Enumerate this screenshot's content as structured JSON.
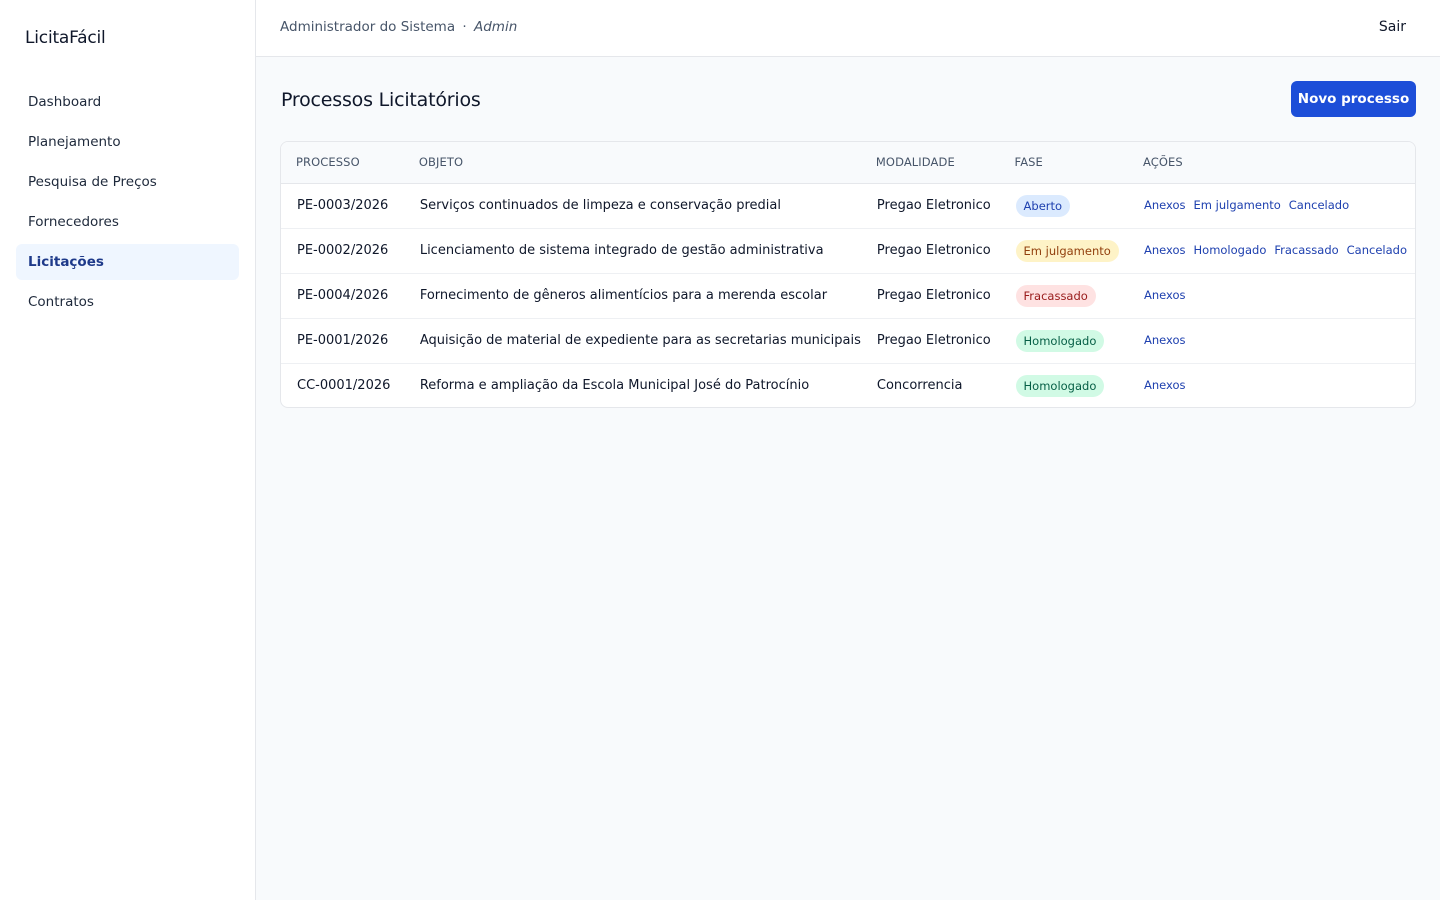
{
  "app": {
    "brand": "LicitaFácil"
  },
  "sidebar": {
    "items": [
      {
        "label": "Dashboard",
        "active": false
      },
      {
        "label": "Planejamento",
        "active": false
      },
      {
        "label": "Pesquisa de Preços",
        "active": false
      },
      {
        "label": "Fornecedores",
        "active": false
      },
      {
        "label": "Licitações",
        "active": true
      },
      {
        "label": "Contratos",
        "active": false
      }
    ]
  },
  "header": {
    "user_name": "Administrador do Sistema",
    "separator": "·",
    "user_role": "Admin",
    "logout_label": "Sair"
  },
  "main": {
    "title": "Processos Licitatórios",
    "new_button_label": "Novo processo",
    "table": {
      "columns": [
        "Processo",
        "Objeto",
        "Modalidade",
        "Fase",
        "Ações"
      ],
      "rows": [
        {
          "processo": "PE-0003/2026",
          "objeto": "Serviços continuados de limpeza e conservação predial",
          "modalidade": "Pregao Eletronico",
          "fase": "Aberto",
          "fase_style": "aberto",
          "acoes": [
            "Anexos",
            "Em julgamento",
            "Cancelado"
          ]
        },
        {
          "processo": "PE-0002/2026",
          "objeto": "Licenciamento de sistema integrado de gestão administrativa",
          "modalidade": "Pregao Eletronico",
          "fase": "Em julgamento",
          "fase_style": "julgamento",
          "acoes": [
            "Anexos",
            "Homologado",
            "Fracassado",
            "Cancelado"
          ]
        },
        {
          "processo": "PE-0004/2026",
          "objeto": "Fornecimento de gêneros alimentícios para a merenda escolar",
          "modalidade": "Pregao Eletronico",
          "fase": "Fracassado",
          "fase_style": "fracassado",
          "acoes": [
            "Anexos"
          ]
        },
        {
          "processo": "PE-0001/2026",
          "objeto": "Aquisição de material de expediente para as secretarias municipais",
          "modalidade": "Pregao Eletronico",
          "fase": "Homologado",
          "fase_style": "homologado",
          "acoes": [
            "Anexos"
          ]
        },
        {
          "processo": "CC-0001/2026",
          "objeto": "Reforma e ampliação da Escola Municipal José do Patrocínio",
          "modalidade": "Concorrencia",
          "fase": "Homologado",
          "fase_style": "homologado",
          "acoes": [
            "Anexos"
          ]
        }
      ]
    }
  },
  "colors": {
    "primary": "#1d4ed8",
    "link": "#1e40af",
    "active_nav_bg": "#eff6ff",
    "background": "#f8fafc"
  }
}
